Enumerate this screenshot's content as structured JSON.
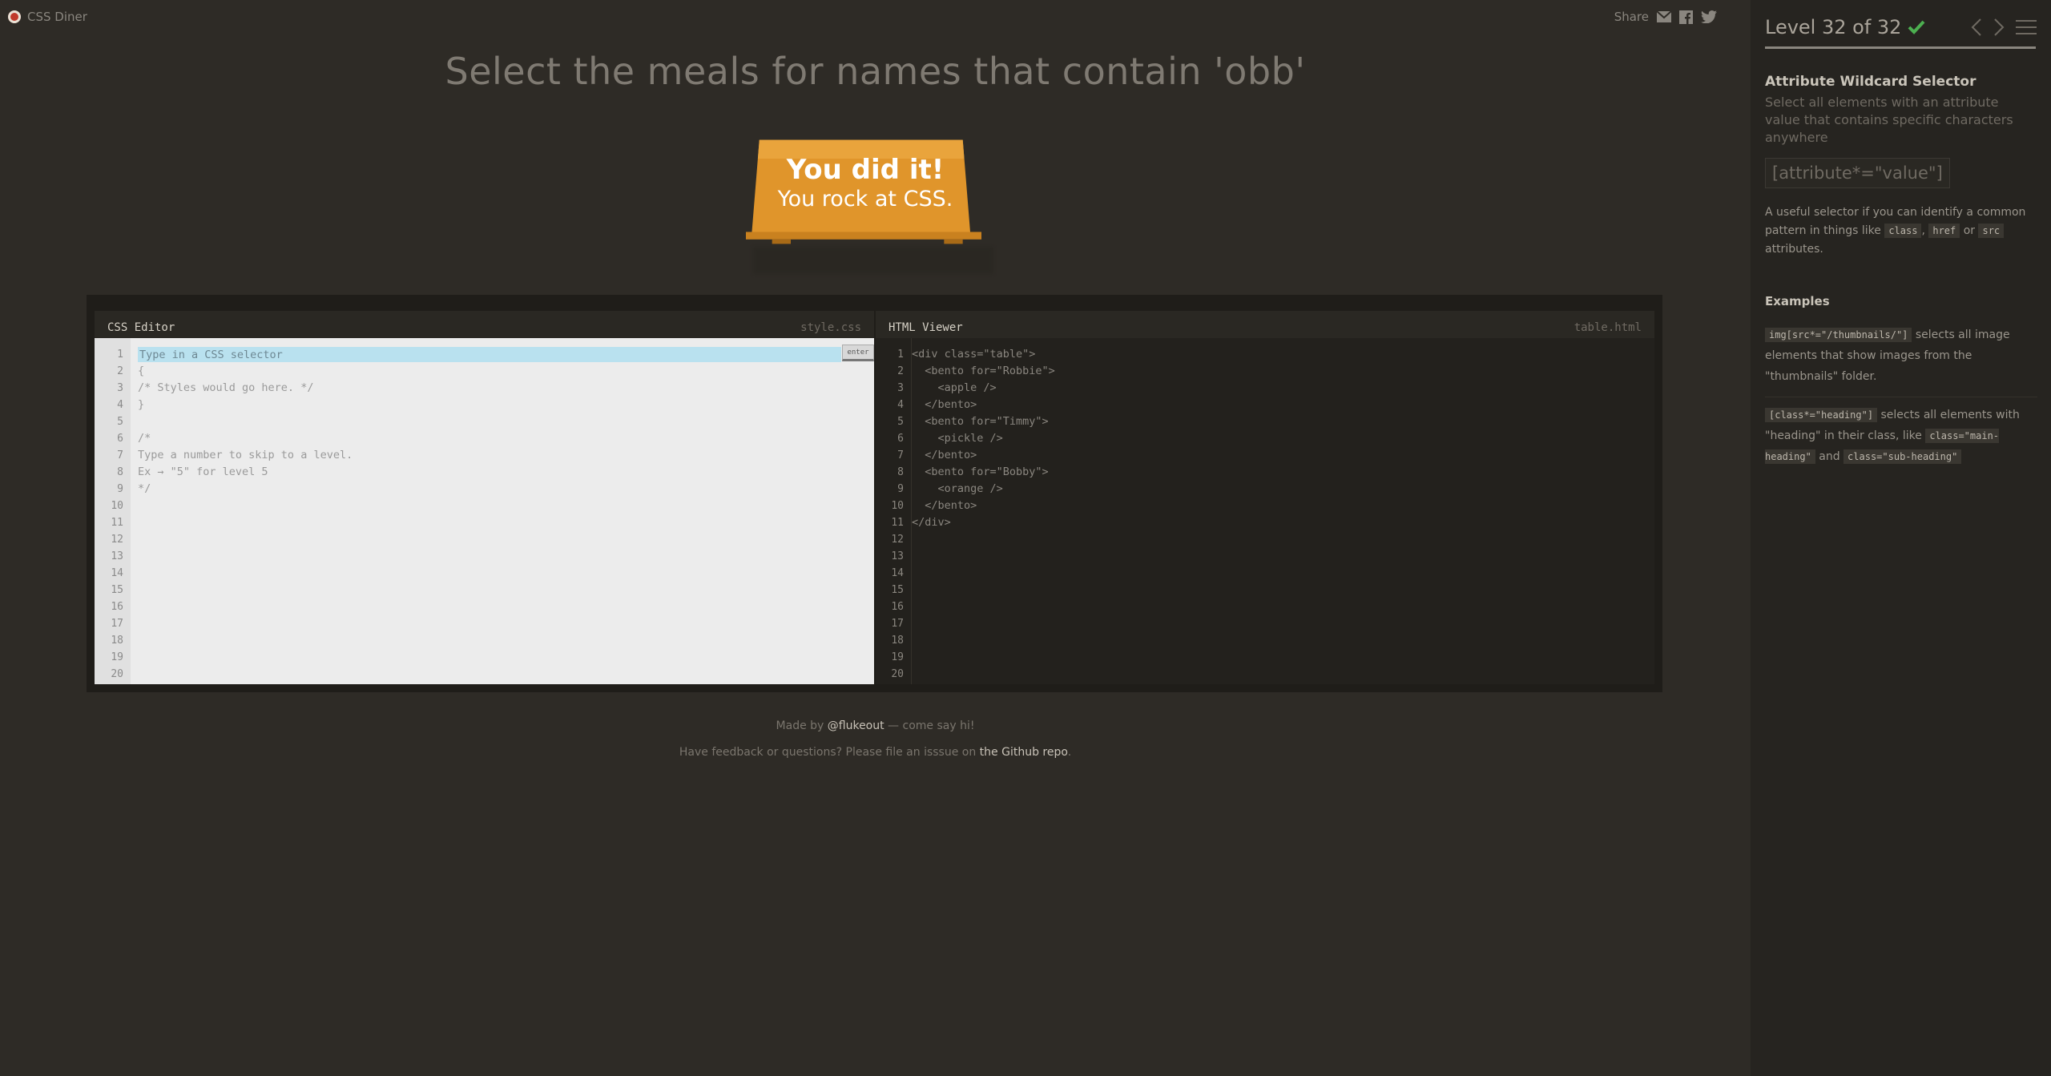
{
  "app": {
    "title": "CSS Diner"
  },
  "share": {
    "label": "Share"
  },
  "order": "Select the meals for names that contain 'obb'",
  "sign": {
    "line1": "You did it!",
    "line2": "You rock at CSS."
  },
  "css_editor": {
    "title": "CSS Editor",
    "filename": "style.css",
    "input_placeholder": "Type in a CSS selector",
    "enter_label": "enter",
    "line_numbers": [
      "1",
      "2",
      "3",
      "4",
      "5",
      "6",
      "7",
      "8",
      "9",
      "10",
      "11",
      "12",
      "13",
      "14",
      "15",
      "16",
      "17",
      "18",
      "19",
      "20"
    ],
    "code": "\n{\n/* Styles would go here. */\n}\n\n/*\nType a number to skip to a level.\nEx → \"5\" for level 5\n*/"
  },
  "html_viewer": {
    "title": "HTML Viewer",
    "filename": "table.html",
    "line_numbers": [
      "1",
      "2",
      "3",
      "4",
      "5",
      "6",
      "7",
      "8",
      "9",
      "10",
      "11",
      "12",
      "13",
      "14",
      "15",
      "16",
      "17",
      "18",
      "19",
      "20"
    ],
    "code": "<div class=\"table\">\n  <bento for=\"Robbie\">\n    <apple />\n  </bento>\n  <bento for=\"Timmy\">\n    <pickle />\n  </bento>\n  <bento for=\"Bobby\">\n    <orange />\n  </bento>\n</div>"
  },
  "footer": {
    "made_by_prefix": "Made by ",
    "made_by_link": "@flukeout",
    "made_by_suffix": " — come say hi!",
    "feedback_prefix": "Have feedback or questions? Please file an isssue on ",
    "feedback_link": "the Github repo",
    "feedback_suffix": "."
  },
  "sidebar": {
    "level_label": "Level 32 of 32",
    "progress": 1.0,
    "title": "Attribute Wildcard Selector",
    "description": "Select all elements with an attribute value that contains specific characters anywhere",
    "syntax": "[attribute*=\"value\"]",
    "hint_part1": "A useful selector if you can identify a common pattern in things like ",
    "hint_tag1": "class",
    "hint_sep1": ", ",
    "hint_tag2": "href",
    "hint_sep2": " or ",
    "hint_tag3": "src",
    "hint_part2": " attributes.",
    "examples_heading": "Examples",
    "ex1_code": "img[src*=\"/thumbnails/\"]",
    "ex1_text": " selects all image elements that show images from the \"thumbnails\" folder.",
    "ex2_code": "[class*=\"heading\"]",
    "ex2_text1": " selects all elements with \"heading\" in their class, like ",
    "ex2_code2": "class=\"main-heading\"",
    "ex2_text2": " and ",
    "ex2_code3": "class=\"sub-heading\""
  },
  "colors": {
    "sign": "#e0952b",
    "check": "#4caf50",
    "input_highlight": "#b9e1ef"
  }
}
